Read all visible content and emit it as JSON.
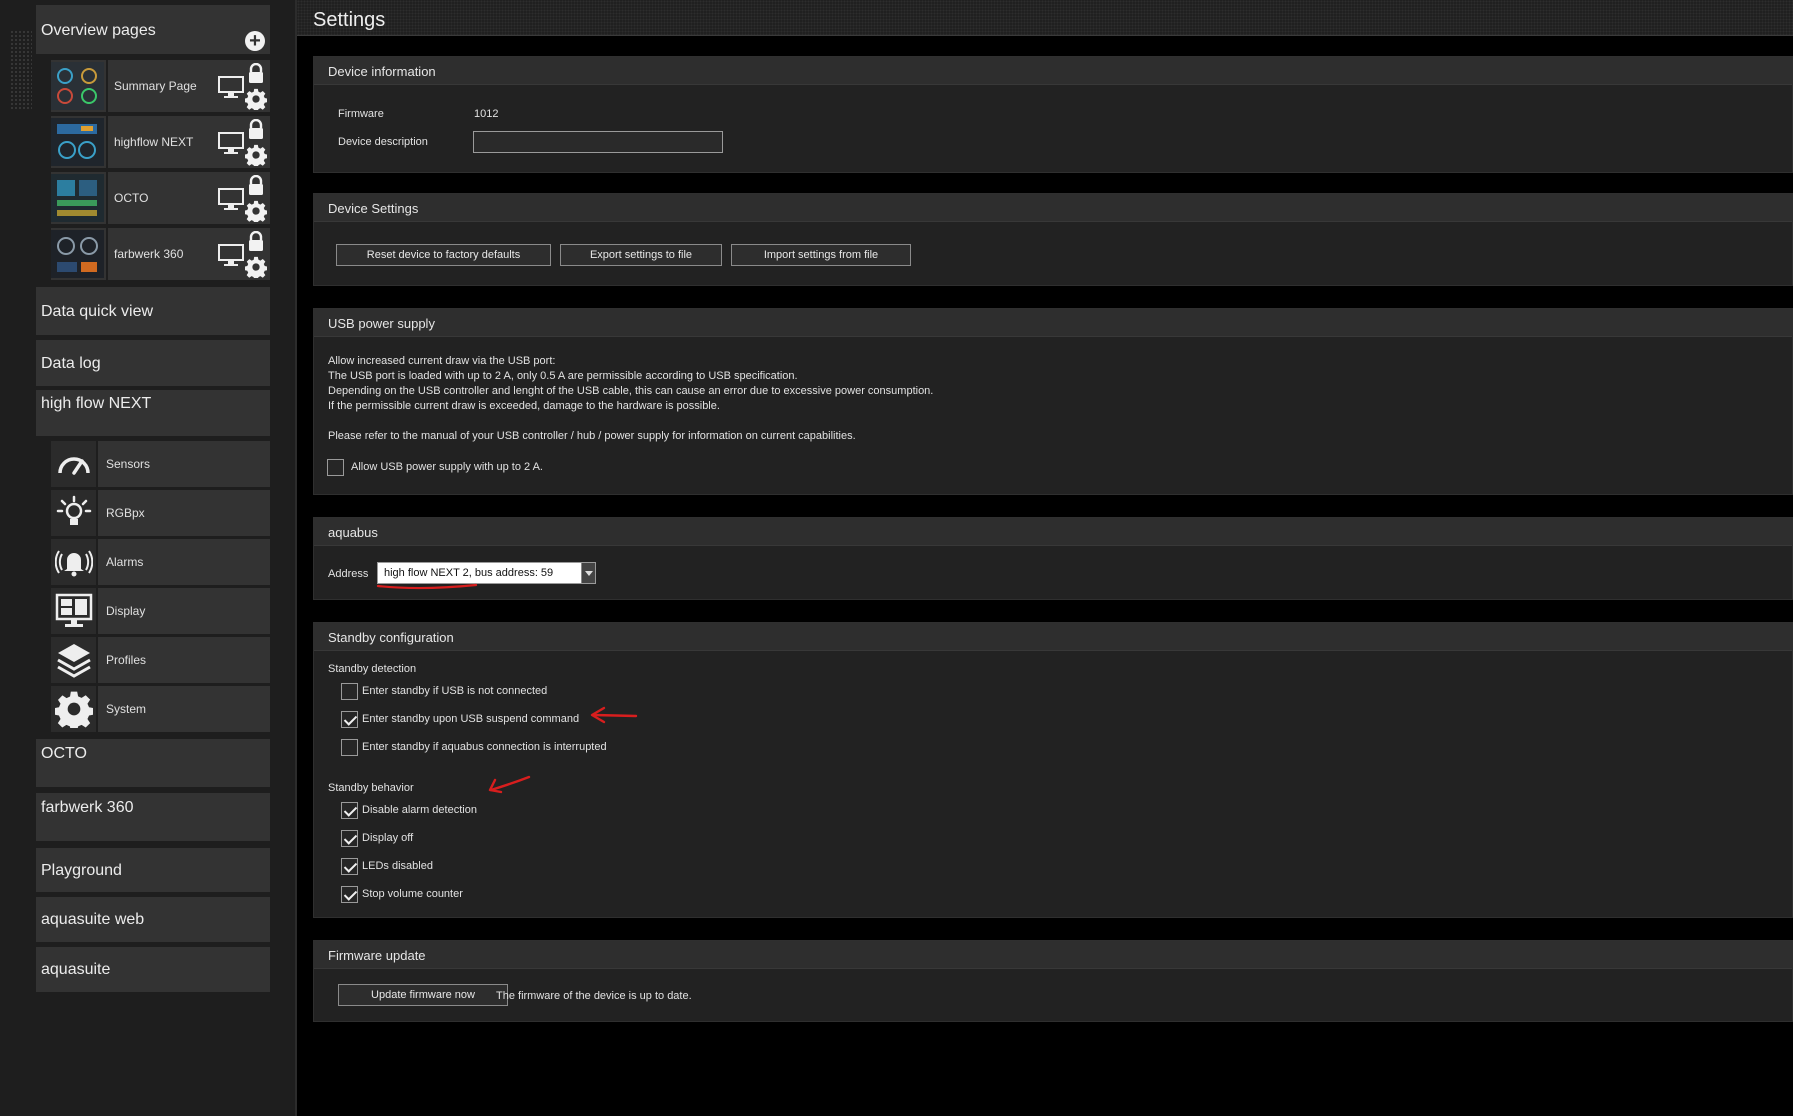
{
  "sidebar": {
    "overview_title": "Overview pages",
    "add_icon": "plus-icon",
    "pages": [
      {
        "label": "Summary Page"
      },
      {
        "label": "highflow NEXT"
      },
      {
        "label": "OCTO"
      },
      {
        "label": "farbwerk 360"
      }
    ],
    "menu": {
      "data_quick_view": "Data quick view",
      "data_log": "Data log",
      "device_highflow": "high flow NEXT",
      "octo": "OCTO",
      "farbwerk": "farbwerk 360",
      "playground": "Playground",
      "aquasuite_web": "aquasuite web",
      "aquasuite": "aquasuite"
    },
    "subitems": [
      {
        "label": "Sensors",
        "icon": "gauge-icon"
      },
      {
        "label": "RGBpx",
        "icon": "lightbulb-icon"
      },
      {
        "label": "Alarms",
        "icon": "bell-icon"
      },
      {
        "label": "Display",
        "icon": "display-icon"
      },
      {
        "label": "Profiles",
        "icon": "layers-icon"
      },
      {
        "label": "System",
        "icon": "gear-icon"
      }
    ]
  },
  "main": {
    "title": "Settings",
    "device_info": {
      "title": "Device information",
      "firmware_label": "Firmware",
      "firmware_value": "1012",
      "description_label": "Device description",
      "description_value": ""
    },
    "device_settings": {
      "title": "Device Settings",
      "reset_label": "Reset device to factory defaults",
      "export_label": "Export settings to file",
      "import_label": "Import settings from file"
    },
    "usb_power": {
      "title": "USB power supply",
      "lines": [
        "Allow increased current draw via the USB port:",
        "The USB port is loaded with up to 2 A, only 0.5 A are permissible according to USB specification.",
        "Depending on the USB controller and lenght of the USB cable, this can cause an error due to excessive power consumption.",
        "If the permissible current draw is exceeded, damage to the hardware is possible."
      ],
      "note": "Please refer to the manual of your USB controller / hub / power supply for information on current capabilities.",
      "checkbox_label": "Allow USB power supply with up to 2 A.",
      "checked": false
    },
    "aquabus": {
      "title": "aquabus",
      "address_label": "Address",
      "address_value": "high flow NEXT 2, bus address: 59"
    },
    "standby": {
      "title": "Standby configuration",
      "detection_title": "Standby detection",
      "detection": [
        {
          "label": "Enter standby if USB is not connected",
          "checked": false
        },
        {
          "label": "Enter standby upon USB suspend command",
          "checked": true
        },
        {
          "label": "Enter standby if aquabus connection is interrupted",
          "checked": false
        }
      ],
      "behavior_title": "Standby behavior",
      "behavior": [
        {
          "label": "Disable alarm detection",
          "checked": true
        },
        {
          "label": "Display off",
          "checked": true
        },
        {
          "label": "LEDs disabled",
          "checked": true
        },
        {
          "label": "Stop volume counter",
          "checked": true
        }
      ]
    },
    "firmware_update": {
      "title": "Firmware update",
      "button_label": "Update firmware now",
      "status": "The firmware of the device is up to date."
    }
  },
  "annotation_color": "#d81e1e"
}
